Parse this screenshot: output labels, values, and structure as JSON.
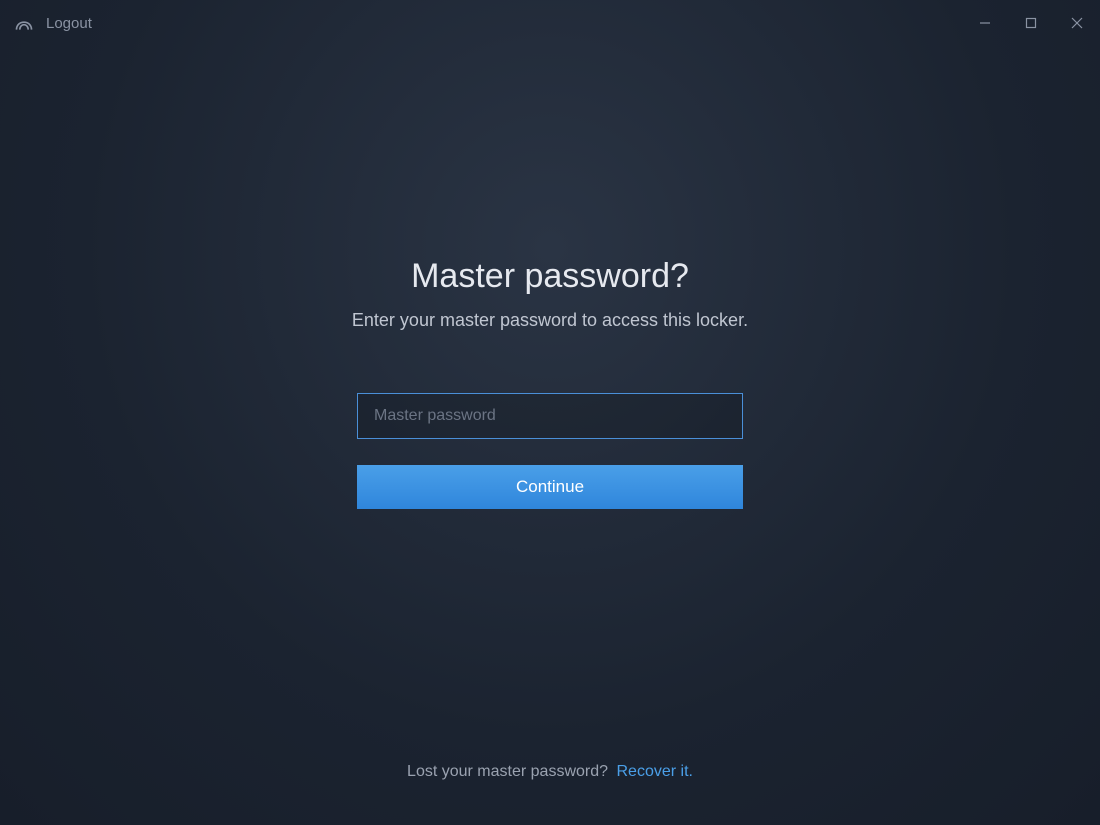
{
  "titlebar": {
    "logout_label": "Logout"
  },
  "main": {
    "heading": "Master password?",
    "subheading": "Enter your master password to access this locker.",
    "password_placeholder": "Master password",
    "password_value": "",
    "continue_label": "Continue"
  },
  "footer": {
    "lost_text": "Lost your master password?",
    "recover_label": "Recover it."
  }
}
